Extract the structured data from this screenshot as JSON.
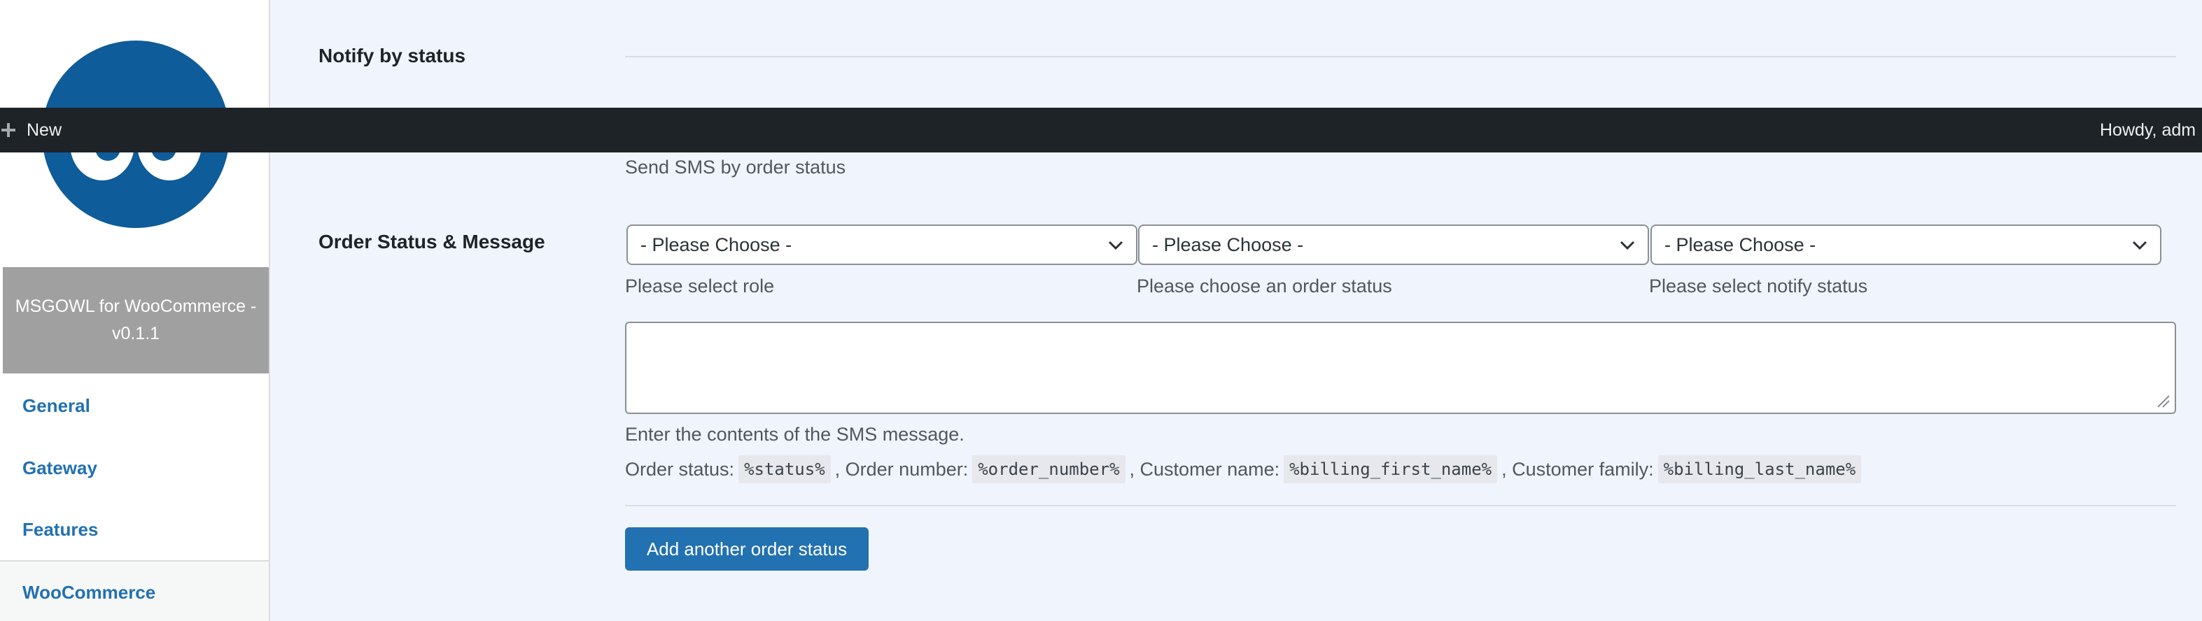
{
  "adminbar": {
    "new_label": "New",
    "howdy_label": "Howdy, adm"
  },
  "sidebar": {
    "plugin_title": "MSGOWL for WooCommerce - v0.1.1",
    "items": [
      {
        "label": "General"
      },
      {
        "label": "Gateway"
      },
      {
        "label": "Features"
      },
      {
        "label": "WooCommerce"
      }
    ]
  },
  "form": {
    "notify_by_status_label": "Notify by status",
    "notify_by_status_desc": "Send SMS by order status",
    "order_status_message_label": "Order Status & Message",
    "selects": [
      {
        "value": "- Please Choose -",
        "hint": "Please select role"
      },
      {
        "value": "- Please Choose -",
        "hint": "Please choose an order status"
      },
      {
        "value": "- Please Choose -",
        "hint": "Please select notify status"
      }
    ],
    "message_value": "",
    "message_desc": "Enter the contents of the SMS message.",
    "placeholders": {
      "status_label": "Order status:",
      "status_code": "%status%",
      "number_label": ", Order number:",
      "number_code": "%order_number%",
      "name_label": ", Customer name:",
      "name_code": "%billing_first_name%",
      "family_label": ", Customer family:",
      "family_code": "%billing_last_name%"
    },
    "add_button_label": "Add another order status"
  },
  "colors": {
    "accent": "#2271b1",
    "adminbar_bg": "#1d2327",
    "page_bg": "#f0f4fd",
    "plugin_box_bg": "#a0a0a0"
  }
}
